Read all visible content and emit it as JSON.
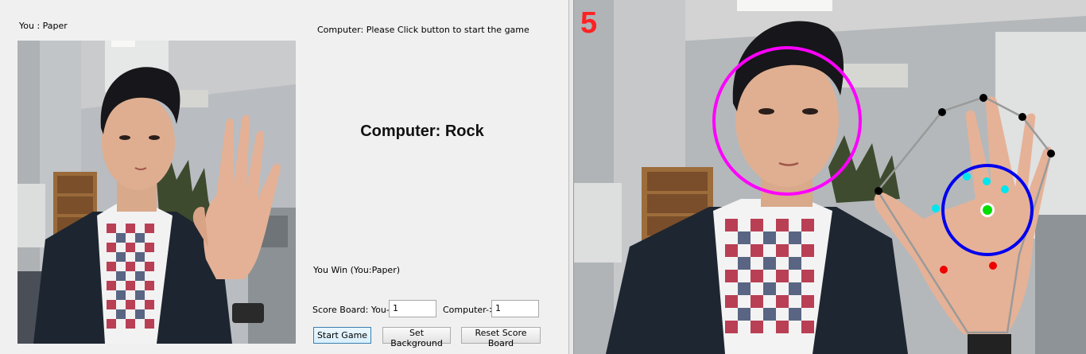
{
  "left": {
    "you_label": "You : Paper",
    "status_text": "Computer: Please Click button to start the game",
    "computer_choice": "Computer: Rock",
    "result_text": "You Win  (You:Paper)",
    "score": {
      "you_label": "Score Board: You->",
      "you_value": "1",
      "computer_label": "Computer->",
      "computer_value": "1"
    },
    "buttons": {
      "start": "Start Game",
      "background": "Set Background",
      "reset": "Reset Score Board"
    }
  },
  "right": {
    "finger_count": "5",
    "colors": {
      "face_circle": "#ff00ff",
      "palm_circle": "#0000ee",
      "palm_center": "#00dd00",
      "fingertips": "#000000",
      "defects": "#00e5ee",
      "wrist_points": "#ee0000",
      "hull": "#9a9a9a"
    }
  }
}
